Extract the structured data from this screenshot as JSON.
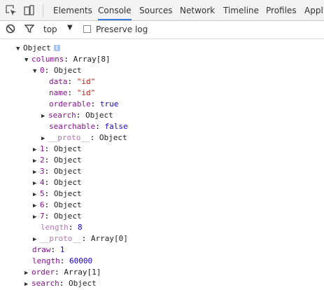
{
  "toolbar": {
    "tabs": [
      "Elements",
      "Console",
      "Sources",
      "Network",
      "Timeline",
      "Profiles",
      "Appli"
    ],
    "active_tab": "Console"
  },
  "filter": {
    "context": "top",
    "preserve_log_label": "Preserve log",
    "preserve_log_checked": false
  },
  "console": {
    "root": {
      "label": "Object",
      "info_badge": "i"
    },
    "columns": {
      "key": "columns",
      "sep": ": ",
      "value": "Array[8]",
      "item0": {
        "key": "0",
        "sep": ": ",
        "value": "Object",
        "data": {
          "key": "data",
          "sep": ": ",
          "value": "\"id\""
        },
        "name": {
          "key": "name",
          "sep": ": ",
          "value": "\"id\""
        },
        "orderable": {
          "key": "orderable",
          "sep": ": ",
          "value": "true"
        },
        "search": {
          "key": "search",
          "sep": ": ",
          "value": "Object"
        },
        "searchable": {
          "key": "searchable",
          "sep": ": ",
          "value": "false"
        },
        "proto": {
          "key": "__proto__",
          "sep": ": ",
          "value": "Object"
        }
      },
      "items": [
        {
          "key": "1",
          "sep": ": ",
          "value": "Object"
        },
        {
          "key": "2",
          "sep": ": ",
          "value": "Object"
        },
        {
          "key": "3",
          "sep": ": ",
          "value": "Object"
        },
        {
          "key": "4",
          "sep": ": ",
          "value": "Object"
        },
        {
          "key": "5",
          "sep": ": ",
          "value": "Object"
        },
        {
          "key": "6",
          "sep": ": ",
          "value": "Object"
        },
        {
          "key": "7",
          "sep": ": ",
          "value": "Object"
        }
      ],
      "length": {
        "key": "length",
        "sep": ": ",
        "value": "8"
      },
      "proto": {
        "key": "__proto__",
        "sep": ": ",
        "value": "Array[0]"
      }
    },
    "draw": {
      "key": "draw",
      "sep": ": ",
      "value": "1"
    },
    "length": {
      "key": "length",
      "sep": ": ",
      "value": "60000"
    },
    "order": {
      "key": "order",
      "sep": ": ",
      "value": "Array[1]"
    },
    "search": {
      "key": "search",
      "sep": ": ",
      "value": "Object"
    }
  }
}
